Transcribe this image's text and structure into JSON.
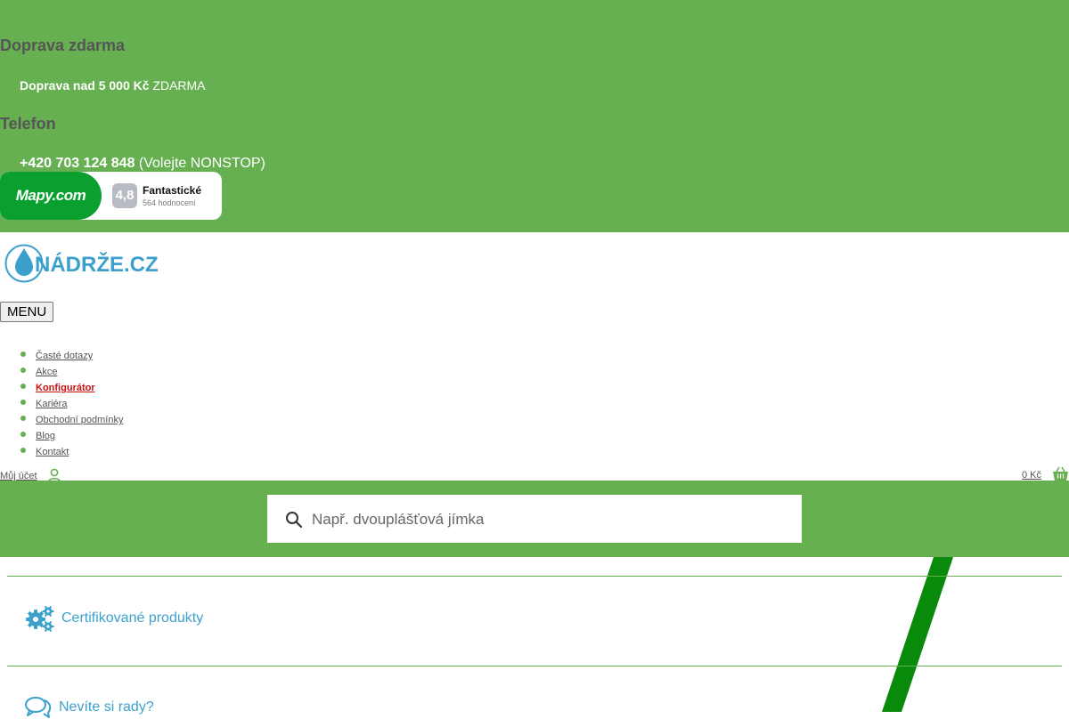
{
  "shipping": {
    "heading": "Doprava zdarma",
    "bold": "Doprava nad 5 000 Kč",
    "rest": " ZDARMA"
  },
  "phone": {
    "heading": "Telefon",
    "number": "+420 703 124 848",
    "note": " (Volejte NONSTOP)"
  },
  "rating": {
    "brand": "Mapy.com",
    "score": "4,8",
    "label": "Fantastické",
    "count": "564 hodnocení"
  },
  "logo": {
    "text": "NÁDRŽE.CZ"
  },
  "menu_button": "MENU",
  "nav": {
    "items": [
      {
        "label": "Časté dotazy"
      },
      {
        "label": "Akce"
      },
      {
        "label": "Konfigurátor"
      },
      {
        "label": "Kariéra"
      },
      {
        "label": "Obchodní podmínky"
      },
      {
        "label": "Blog"
      },
      {
        "label": "Kontakt"
      }
    ]
  },
  "account": {
    "label": "Můj účet"
  },
  "cart": {
    "total": "0 Kč"
  },
  "search": {
    "placeholder": "Např. dvouplášťová jímka"
  },
  "features": [
    {
      "label": "Certifikované produkty",
      "icon": "gears-icon"
    },
    {
      "label": "Nevíte si rady?",
      "icon": "chat-bubbles-icon"
    }
  ],
  "colors": {
    "brand_green": "#66b052",
    "accent_blue": "#3ba1cc",
    "highlight_red": "#cc1111",
    "stripe_green": "#0a8a0a"
  }
}
